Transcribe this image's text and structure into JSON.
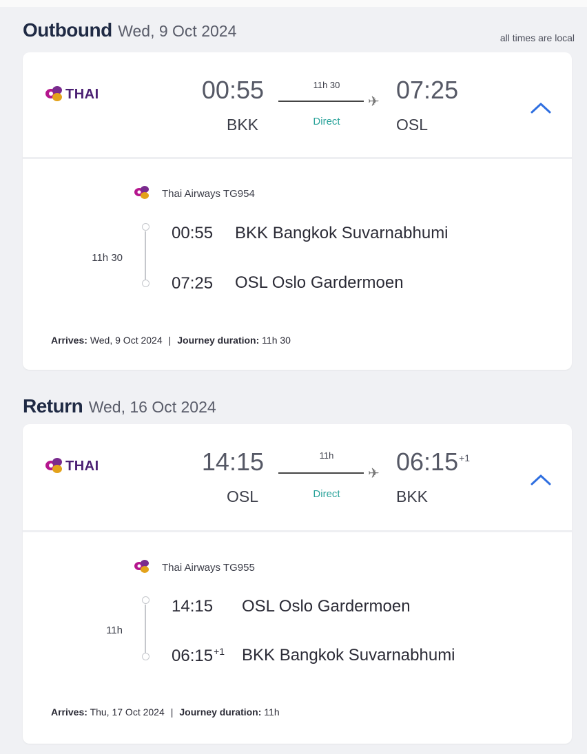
{
  "note": "all times are local",
  "outbound": {
    "title": "Outbound",
    "date": "Wed, 9 Oct 2024",
    "airline_logo_text": "THAI",
    "dep_time": "00:55",
    "dep_code": "BKK",
    "duration": "11h 30",
    "stops": "Direct",
    "arr_time": "07:25",
    "arr_code": "OSL",
    "arr_day_offset": "",
    "carrier": "Thai Airways TG954",
    "leg_duration": "11h 30",
    "stop1_time": "00:55",
    "stop1_place": "BKK Bangkok Suvarnabhumi",
    "stop2_time": "07:25",
    "stop2_time_offset": "",
    "stop2_place": "OSL Oslo Gardermoen",
    "arrives_label": "Arrives:",
    "arrives_value": "Wed, 9 Oct 2024",
    "journey_label": "Journey duration:",
    "journey_value": "11h 30"
  },
  "return": {
    "title": "Return",
    "date": "Wed, 16 Oct 2024",
    "airline_logo_text": "THAI",
    "dep_time": "14:15",
    "dep_code": "OSL",
    "duration": "11h",
    "stops": "Direct",
    "arr_time": "06:15",
    "arr_code": "BKK",
    "arr_day_offset": "+1",
    "carrier": "Thai Airways TG955",
    "leg_duration": "11h",
    "stop1_time": "14:15",
    "stop1_place": "OSL Oslo Gardermoen",
    "stop2_time": "06:15",
    "stop2_time_offset": "+1",
    "stop2_place": "BKK Bangkok Suvarnabhumi",
    "arrives_label": "Arrives:",
    "arrives_value": "Thu, 17 Oct 2024",
    "journey_label": "Journey duration:",
    "journey_value": "11h"
  },
  "icons": {
    "airline_logo": "thai-orchid-icon",
    "expand": "chevron-up-icon",
    "plane": "plane-icon"
  },
  "colors": {
    "background": "#f0f1f4",
    "card": "#ffffff",
    "direct": "#2aa39a",
    "chevron": "#2f6fe0",
    "brand_purple": "#4b2073",
    "brand_magenta": "#b5168e",
    "brand_gold": "#e3a21a"
  }
}
